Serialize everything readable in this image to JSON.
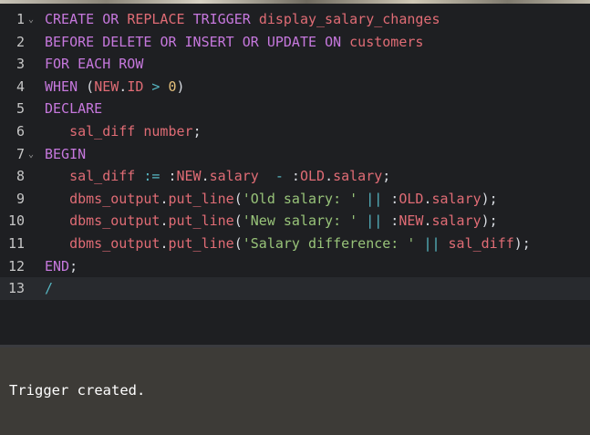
{
  "editor": {
    "lines": [
      {
        "num": "1",
        "fold": "⌄",
        "tokens": [
          [
            "kw",
            "CREATE"
          ],
          [
            "plain",
            " "
          ],
          [
            "kw",
            "OR"
          ],
          [
            "plain",
            " "
          ],
          [
            "id",
            "REPLACE"
          ],
          [
            "plain",
            " "
          ],
          [
            "kw",
            "TRIGGER"
          ],
          [
            "plain",
            " "
          ],
          [
            "id",
            "display_salary_changes"
          ]
        ]
      },
      {
        "num": "2",
        "fold": "",
        "tokens": [
          [
            "kw",
            "BEFORE"
          ],
          [
            "plain",
            " "
          ],
          [
            "kw",
            "DELETE"
          ],
          [
            "plain",
            " "
          ],
          [
            "kw",
            "OR"
          ],
          [
            "plain",
            " "
          ],
          [
            "kw",
            "INSERT"
          ],
          [
            "plain",
            " "
          ],
          [
            "kw",
            "OR"
          ],
          [
            "plain",
            " "
          ],
          [
            "kw",
            "UPDATE"
          ],
          [
            "plain",
            " "
          ],
          [
            "kw",
            "ON"
          ],
          [
            "plain",
            " "
          ],
          [
            "id",
            "customers"
          ]
        ]
      },
      {
        "num": "3",
        "fold": "",
        "tokens": [
          [
            "kw",
            "FOR"
          ],
          [
            "plain",
            " "
          ],
          [
            "kw",
            "EACH"
          ],
          [
            "plain",
            " "
          ],
          [
            "kw",
            "ROW"
          ]
        ]
      },
      {
        "num": "4",
        "fold": "",
        "tokens": [
          [
            "kw",
            "WHEN"
          ],
          [
            "plain",
            " ("
          ],
          [
            "id",
            "NEW"
          ],
          [
            "plain",
            "."
          ],
          [
            "id",
            "ID"
          ],
          [
            "plain",
            " "
          ],
          [
            "op",
            ">"
          ],
          [
            "plain",
            " "
          ],
          [
            "num",
            "0"
          ],
          [
            "plain",
            ")"
          ]
        ]
      },
      {
        "num": "5",
        "fold": "",
        "tokens": [
          [
            "kw",
            "DECLARE"
          ]
        ]
      },
      {
        "num": "6",
        "fold": "",
        "tokens": [
          [
            "plain",
            "   "
          ],
          [
            "id",
            "sal_diff"
          ],
          [
            "plain",
            " "
          ],
          [
            "id",
            "number"
          ],
          [
            "plain",
            ";"
          ]
        ]
      },
      {
        "num": "7",
        "fold": "⌄",
        "tokens": [
          [
            "kw",
            "BEGIN"
          ]
        ]
      },
      {
        "num": "8",
        "fold": "",
        "tokens": [
          [
            "plain",
            "   "
          ],
          [
            "id",
            "sal_diff"
          ],
          [
            "plain",
            " "
          ],
          [
            "op",
            ":="
          ],
          [
            "plain",
            " :"
          ],
          [
            "id",
            "NEW"
          ],
          [
            "plain",
            "."
          ],
          [
            "id",
            "salary"
          ],
          [
            "plain",
            "  "
          ],
          [
            "op",
            "-"
          ],
          [
            "plain",
            " :"
          ],
          [
            "id",
            "OLD"
          ],
          [
            "plain",
            "."
          ],
          [
            "id",
            "salary"
          ],
          [
            "plain",
            ";"
          ]
        ]
      },
      {
        "num": "9",
        "fold": "",
        "tokens": [
          [
            "plain",
            "   "
          ],
          [
            "id",
            "dbms_output"
          ],
          [
            "plain",
            "."
          ],
          [
            "id",
            "put_line"
          ],
          [
            "plain",
            "("
          ],
          [
            "str",
            "'Old salary: '"
          ],
          [
            "plain",
            " "
          ],
          [
            "op",
            "||"
          ],
          [
            "plain",
            " :"
          ],
          [
            "id",
            "OLD"
          ],
          [
            "plain",
            "."
          ],
          [
            "id",
            "salary"
          ],
          [
            "plain",
            ");"
          ]
        ]
      },
      {
        "num": "10",
        "fold": "",
        "tokens": [
          [
            "plain",
            "   "
          ],
          [
            "id",
            "dbms_output"
          ],
          [
            "plain",
            "."
          ],
          [
            "id",
            "put_line"
          ],
          [
            "plain",
            "("
          ],
          [
            "str",
            "'New salary: '"
          ],
          [
            "plain",
            " "
          ],
          [
            "op",
            "||"
          ],
          [
            "plain",
            " :"
          ],
          [
            "id",
            "NEW"
          ],
          [
            "plain",
            "."
          ],
          [
            "id",
            "salary"
          ],
          [
            "plain",
            ");"
          ]
        ]
      },
      {
        "num": "11",
        "fold": "",
        "tokens": [
          [
            "plain",
            "   "
          ],
          [
            "id",
            "dbms_output"
          ],
          [
            "plain",
            "."
          ],
          [
            "id",
            "put_line"
          ],
          [
            "plain",
            "("
          ],
          [
            "str",
            "'Salary difference: '"
          ],
          [
            "plain",
            " "
          ],
          [
            "op",
            "||"
          ],
          [
            "plain",
            " "
          ],
          [
            "id",
            "sal_diff"
          ],
          [
            "plain",
            ");"
          ]
        ]
      },
      {
        "num": "12",
        "fold": "",
        "tokens": [
          [
            "kw",
            "END"
          ],
          [
            "plain",
            ";"
          ]
        ]
      },
      {
        "num": "13",
        "fold": "",
        "tokens": [
          [
            "slash",
            "/"
          ]
        ],
        "active": true
      }
    ]
  },
  "output": {
    "text": "Trigger created."
  },
  "colors": {
    "editor_bg": "#1e1f22",
    "output_bg": "#3d3b37",
    "keyword": "#c678dd",
    "identifier": "#e06c75",
    "string": "#98c379",
    "operator": "#56b6c2",
    "number": "#e5c07b"
  }
}
